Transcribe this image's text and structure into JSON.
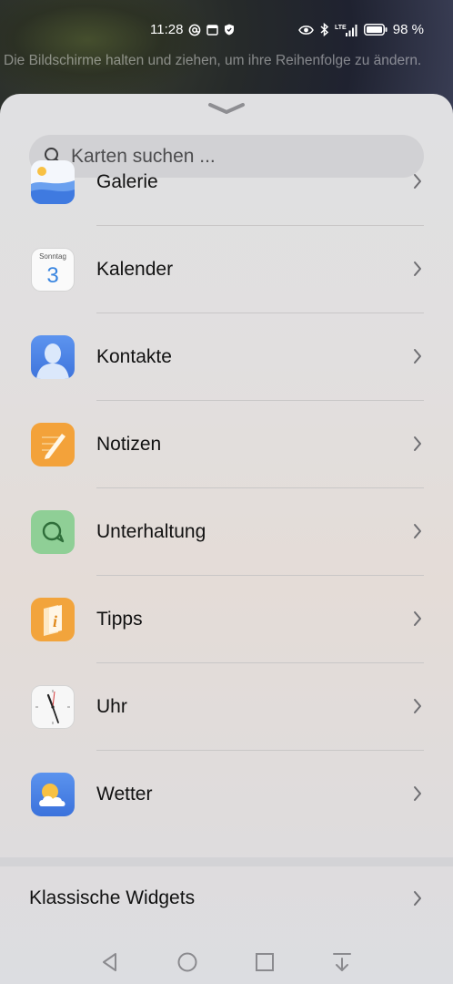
{
  "status_bar": {
    "time": "11:28",
    "battery": "98 %",
    "network_badge": "LTE",
    "left_icons": [
      "at-icon",
      "calendar-icon",
      "shield-icon"
    ],
    "right_icons": [
      "eye-icon",
      "bluetooth-icon",
      "signal-icon",
      "battery-icon"
    ]
  },
  "hint": "Die Bildschirme halten und ziehen, um ihre Reihenfolge zu ändern.",
  "search": {
    "placeholder": "Karten suchen ..."
  },
  "apps": [
    {
      "id": "galerie",
      "label": "Galerie",
      "icon": "gallery-icon"
    },
    {
      "id": "kalender",
      "label": "Kalender",
      "icon": "calendar-app-icon",
      "icon_weekday": "Sonntag",
      "icon_day": "3"
    },
    {
      "id": "kontakte",
      "label": "Kontakte",
      "icon": "contacts-icon"
    },
    {
      "id": "notizen",
      "label": "Notizen",
      "icon": "notes-icon"
    },
    {
      "id": "unterhaltung",
      "label": "Unterhaltung",
      "icon": "chat-icon"
    },
    {
      "id": "tipps",
      "label": "Tipps",
      "icon": "tips-icon"
    },
    {
      "id": "uhr",
      "label": "Uhr",
      "icon": "clock-icon"
    },
    {
      "id": "wetter",
      "label": "Wetter",
      "icon": "weather-icon"
    }
  ],
  "classic_widgets": {
    "label": "Klassische Widgets"
  },
  "navigation": [
    "back-icon",
    "home-icon",
    "recents-icon",
    "notification-shade-icon"
  ],
  "colors": {
    "accent_blue": "#4a7fe0",
    "notes_orange": "#f3a23a",
    "chat_green": "#8fcf96",
    "tips_orange": "#f2a43c"
  }
}
